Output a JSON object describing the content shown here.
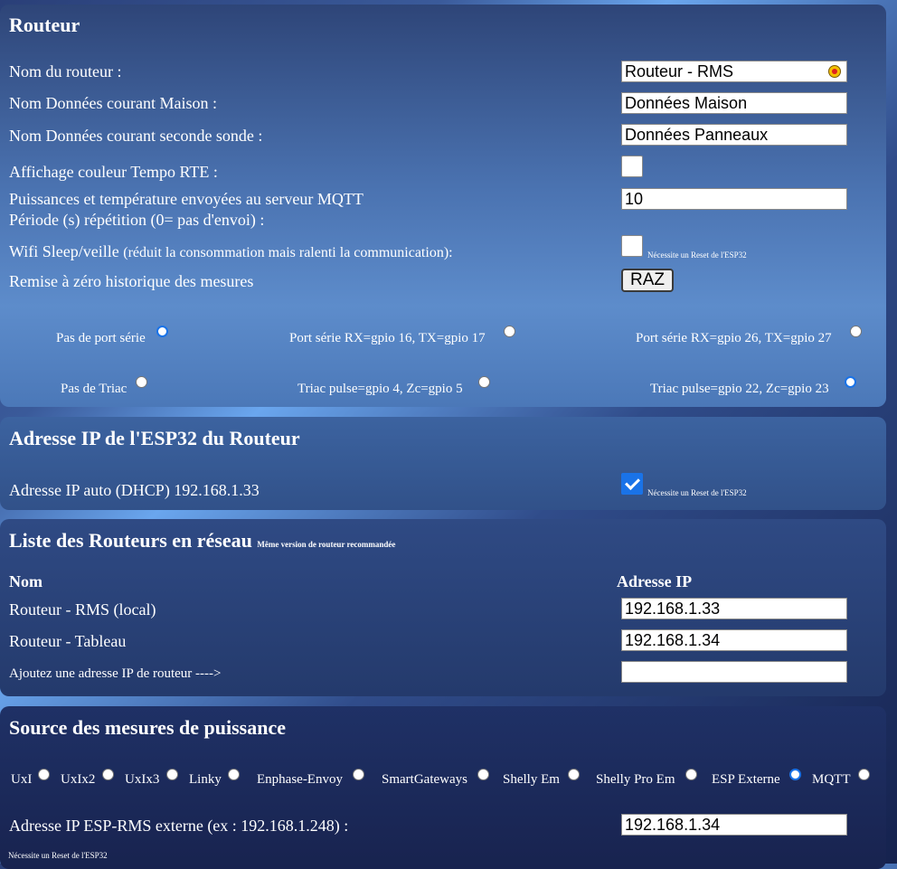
{
  "routeur": {
    "title": "Routeur",
    "nom_routeur_label": "Nom du routeur :",
    "nom_routeur_value": "Routeur - RMS",
    "nom_maison_label": "Nom Données courant Maison :",
    "nom_maison_value": "Données Maison",
    "nom_seconde_label": "Nom Données courant seconde sonde :",
    "nom_seconde_value": "Données Panneaux",
    "tempo_label": "Affichage couleur Tempo RTE :",
    "tempo_checked": false,
    "mqtt_label_line1": "Puissances et température envoyées au serveur MQTT",
    "mqtt_label_line2": "Période (s) répétition (0= pas d'envoi) :",
    "mqtt_value": "10",
    "wifi_label_main": "Wifi Sleep/veille",
    "wifi_label_note": "(réduit la consommation mais ralenti la communication):",
    "wifi_checked": false,
    "reset_note": "Nécessite un Reset de l'ESP32",
    "raz_label": "Remise à zéro historique des mesures",
    "raz_button": "RAZ",
    "port_options": [
      {
        "label": "Pas de port série",
        "selected": true
      },
      {
        "label": "Port série RX=gpio 16, TX=gpio 17",
        "selected": false
      },
      {
        "label": "Port série RX=gpio 26, TX=gpio 27",
        "selected": false
      }
    ],
    "triac_options": [
      {
        "label": "Pas de Triac",
        "selected": false
      },
      {
        "label": "Triac pulse=gpio 4, Zc=gpio 5",
        "selected": false
      },
      {
        "label": "Triac pulse=gpio 22, Zc=gpio 23",
        "selected": true
      }
    ]
  },
  "ip": {
    "title": "Adresse IP de l'ESP32 du Routeur",
    "dhcp_label": "Adresse IP auto (DHCP) 192.168.1.33",
    "dhcp_checked": true,
    "reset_note": "Nécessite un Reset de l'ESP32"
  },
  "liste": {
    "title": "Liste des Routeurs en réseau",
    "title_note": "Même version de routeur recommandée",
    "col_nom": "Nom",
    "col_ip": "Adresse IP",
    "rows": [
      {
        "name": "Routeur - RMS (local)",
        "ip": "192.168.1.33"
      },
      {
        "name": "Routeur - Tableau",
        "ip": "192.168.1.34"
      }
    ],
    "add_label": "Ajoutez une adresse IP de routeur ---->",
    "add_value": ""
  },
  "source": {
    "title": "Source des mesures de puissance",
    "options": [
      {
        "label": "UxI",
        "selected": false
      },
      {
        "label": "UxIx2",
        "selected": false
      },
      {
        "label": "UxIx3",
        "selected": false
      },
      {
        "label": "Linky",
        "selected": false
      },
      {
        "label": "Enphase-Envoy",
        "selected": false
      },
      {
        "label": "SmartGateways",
        "selected": false
      },
      {
        "label": "Shelly Em",
        "selected": false
      },
      {
        "label": "Shelly Pro Em",
        "selected": false
      },
      {
        "label": "ESP Externe",
        "selected": true
      },
      {
        "label": "MQTT",
        "selected": false
      }
    ],
    "ext_ip_label": "Adresse IP ESP-RMS externe (ex : 192.168.1.248) :",
    "ext_ip_value": "192.168.1.34",
    "reset_note": "Nécessite un Reset de l'ESP32"
  },
  "colors": {
    "accent": "#1a73e8",
    "text": "#ffffff"
  }
}
